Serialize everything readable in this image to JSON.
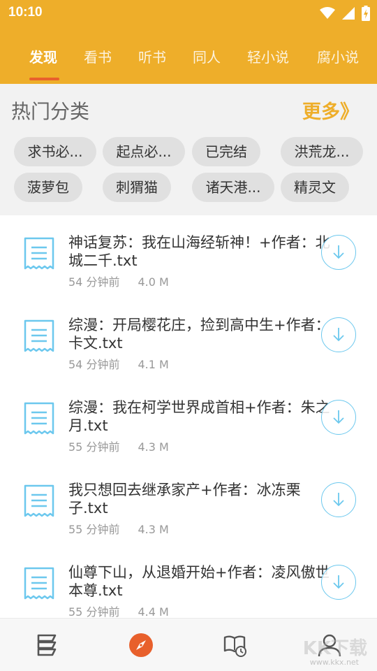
{
  "status_bar": {
    "time": "10:10"
  },
  "tabs": [
    {
      "label": "发现",
      "active": true
    },
    {
      "label": "看书"
    },
    {
      "label": "听书"
    },
    {
      "label": "同人"
    },
    {
      "label": "轻小说"
    },
    {
      "label": "腐小说"
    }
  ],
  "categories": {
    "title": "热门分类",
    "more": "更多》",
    "chips": [
      "求书必...",
      "起点必...",
      "已完结",
      "洪荒龙...",
      "菠萝包",
      "刺猬猫",
      "诸天港...",
      "精灵文"
    ]
  },
  "items": [
    {
      "title": "神话复苏：我在山海经斩神！+作者：北城二千.txt",
      "time": "54 分钟前",
      "size": "4.0 M"
    },
    {
      "title": "综漫：开局樱花庄，捡到高中生+作者：卡文.txt",
      "time": "54 分钟前",
      "size": "4.1 M"
    },
    {
      "title": "综漫：我在柯学世界成首相+作者：朱之月.txt",
      "time": "55 分钟前",
      "size": "4.3 M"
    },
    {
      "title": "我只想回去继承家产+作者：冰冻栗子.txt",
      "time": "55 分钟前",
      "size": "4.3 M"
    },
    {
      "title": "仙尊下山，从退婚开始+作者：凌风傲世本尊.txt",
      "time": "55 分钟前",
      "size": "4.4 M"
    }
  ],
  "bottom_nav": [
    {
      "icon": "bookshelf-icon"
    },
    {
      "icon": "compass-icon",
      "active": true
    },
    {
      "icon": "history-icon"
    },
    {
      "icon": "user-icon"
    }
  ],
  "watermark": {
    "text": "KK下载",
    "url": "www.kkx.net"
  },
  "colors": {
    "header": "#EEAE2A",
    "accent": "#E8602C",
    "download": "#6CC8EE"
  }
}
